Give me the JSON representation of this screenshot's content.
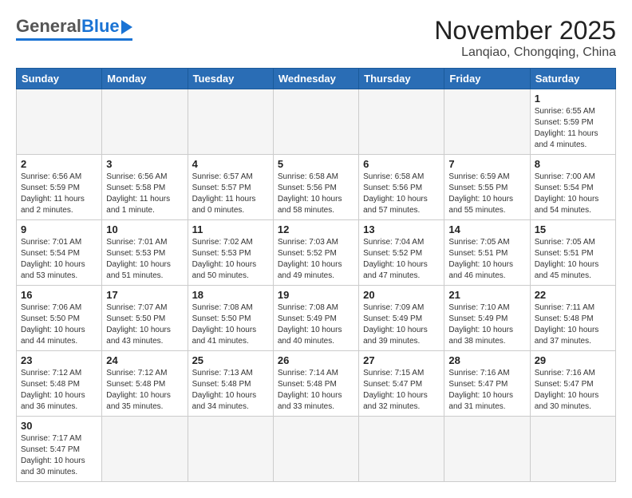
{
  "logo": {
    "general": "General",
    "blue": "Blue"
  },
  "title": "November 2025",
  "subtitle": "Lanqiao, Chongqing, China",
  "weekdays": [
    "Sunday",
    "Monday",
    "Tuesday",
    "Wednesday",
    "Thursday",
    "Friday",
    "Saturday"
  ],
  "weeks": [
    [
      {
        "day": "",
        "info": ""
      },
      {
        "day": "",
        "info": ""
      },
      {
        "day": "",
        "info": ""
      },
      {
        "day": "",
        "info": ""
      },
      {
        "day": "",
        "info": ""
      },
      {
        "day": "",
        "info": ""
      },
      {
        "day": "1",
        "info": "Sunrise: 6:55 AM\nSunset: 5:59 PM\nDaylight: 11 hours and 4 minutes."
      }
    ],
    [
      {
        "day": "2",
        "info": "Sunrise: 6:56 AM\nSunset: 5:59 PM\nDaylight: 11 hours and 2 minutes."
      },
      {
        "day": "3",
        "info": "Sunrise: 6:56 AM\nSunset: 5:58 PM\nDaylight: 11 hours and 1 minute."
      },
      {
        "day": "4",
        "info": "Sunrise: 6:57 AM\nSunset: 5:57 PM\nDaylight: 11 hours and 0 minutes."
      },
      {
        "day": "5",
        "info": "Sunrise: 6:58 AM\nSunset: 5:56 PM\nDaylight: 10 hours and 58 minutes."
      },
      {
        "day": "6",
        "info": "Sunrise: 6:58 AM\nSunset: 5:56 PM\nDaylight: 10 hours and 57 minutes."
      },
      {
        "day": "7",
        "info": "Sunrise: 6:59 AM\nSunset: 5:55 PM\nDaylight: 10 hours and 55 minutes."
      },
      {
        "day": "8",
        "info": "Sunrise: 7:00 AM\nSunset: 5:54 PM\nDaylight: 10 hours and 54 minutes."
      }
    ],
    [
      {
        "day": "9",
        "info": "Sunrise: 7:01 AM\nSunset: 5:54 PM\nDaylight: 10 hours and 53 minutes."
      },
      {
        "day": "10",
        "info": "Sunrise: 7:01 AM\nSunset: 5:53 PM\nDaylight: 10 hours and 51 minutes."
      },
      {
        "day": "11",
        "info": "Sunrise: 7:02 AM\nSunset: 5:53 PM\nDaylight: 10 hours and 50 minutes."
      },
      {
        "day": "12",
        "info": "Sunrise: 7:03 AM\nSunset: 5:52 PM\nDaylight: 10 hours and 49 minutes."
      },
      {
        "day": "13",
        "info": "Sunrise: 7:04 AM\nSunset: 5:52 PM\nDaylight: 10 hours and 47 minutes."
      },
      {
        "day": "14",
        "info": "Sunrise: 7:05 AM\nSunset: 5:51 PM\nDaylight: 10 hours and 46 minutes."
      },
      {
        "day": "15",
        "info": "Sunrise: 7:05 AM\nSunset: 5:51 PM\nDaylight: 10 hours and 45 minutes."
      }
    ],
    [
      {
        "day": "16",
        "info": "Sunrise: 7:06 AM\nSunset: 5:50 PM\nDaylight: 10 hours and 44 minutes."
      },
      {
        "day": "17",
        "info": "Sunrise: 7:07 AM\nSunset: 5:50 PM\nDaylight: 10 hours and 43 minutes."
      },
      {
        "day": "18",
        "info": "Sunrise: 7:08 AM\nSunset: 5:50 PM\nDaylight: 10 hours and 41 minutes."
      },
      {
        "day": "19",
        "info": "Sunrise: 7:08 AM\nSunset: 5:49 PM\nDaylight: 10 hours and 40 minutes."
      },
      {
        "day": "20",
        "info": "Sunrise: 7:09 AM\nSunset: 5:49 PM\nDaylight: 10 hours and 39 minutes."
      },
      {
        "day": "21",
        "info": "Sunrise: 7:10 AM\nSunset: 5:49 PM\nDaylight: 10 hours and 38 minutes."
      },
      {
        "day": "22",
        "info": "Sunrise: 7:11 AM\nSunset: 5:48 PM\nDaylight: 10 hours and 37 minutes."
      }
    ],
    [
      {
        "day": "23",
        "info": "Sunrise: 7:12 AM\nSunset: 5:48 PM\nDaylight: 10 hours and 36 minutes."
      },
      {
        "day": "24",
        "info": "Sunrise: 7:12 AM\nSunset: 5:48 PM\nDaylight: 10 hours and 35 minutes."
      },
      {
        "day": "25",
        "info": "Sunrise: 7:13 AM\nSunset: 5:48 PM\nDaylight: 10 hours and 34 minutes."
      },
      {
        "day": "26",
        "info": "Sunrise: 7:14 AM\nSunset: 5:48 PM\nDaylight: 10 hours and 33 minutes."
      },
      {
        "day": "27",
        "info": "Sunrise: 7:15 AM\nSunset: 5:47 PM\nDaylight: 10 hours and 32 minutes."
      },
      {
        "day": "28",
        "info": "Sunrise: 7:16 AM\nSunset: 5:47 PM\nDaylight: 10 hours and 31 minutes."
      },
      {
        "day": "29",
        "info": "Sunrise: 7:16 AM\nSunset: 5:47 PM\nDaylight: 10 hours and 30 minutes."
      }
    ],
    [
      {
        "day": "30",
        "info": "Sunrise: 7:17 AM\nSunset: 5:47 PM\nDaylight: 10 hours and 30 minutes."
      },
      {
        "day": "",
        "info": ""
      },
      {
        "day": "",
        "info": ""
      },
      {
        "day": "",
        "info": ""
      },
      {
        "day": "",
        "info": ""
      },
      {
        "day": "",
        "info": ""
      },
      {
        "day": "",
        "info": ""
      }
    ]
  ]
}
